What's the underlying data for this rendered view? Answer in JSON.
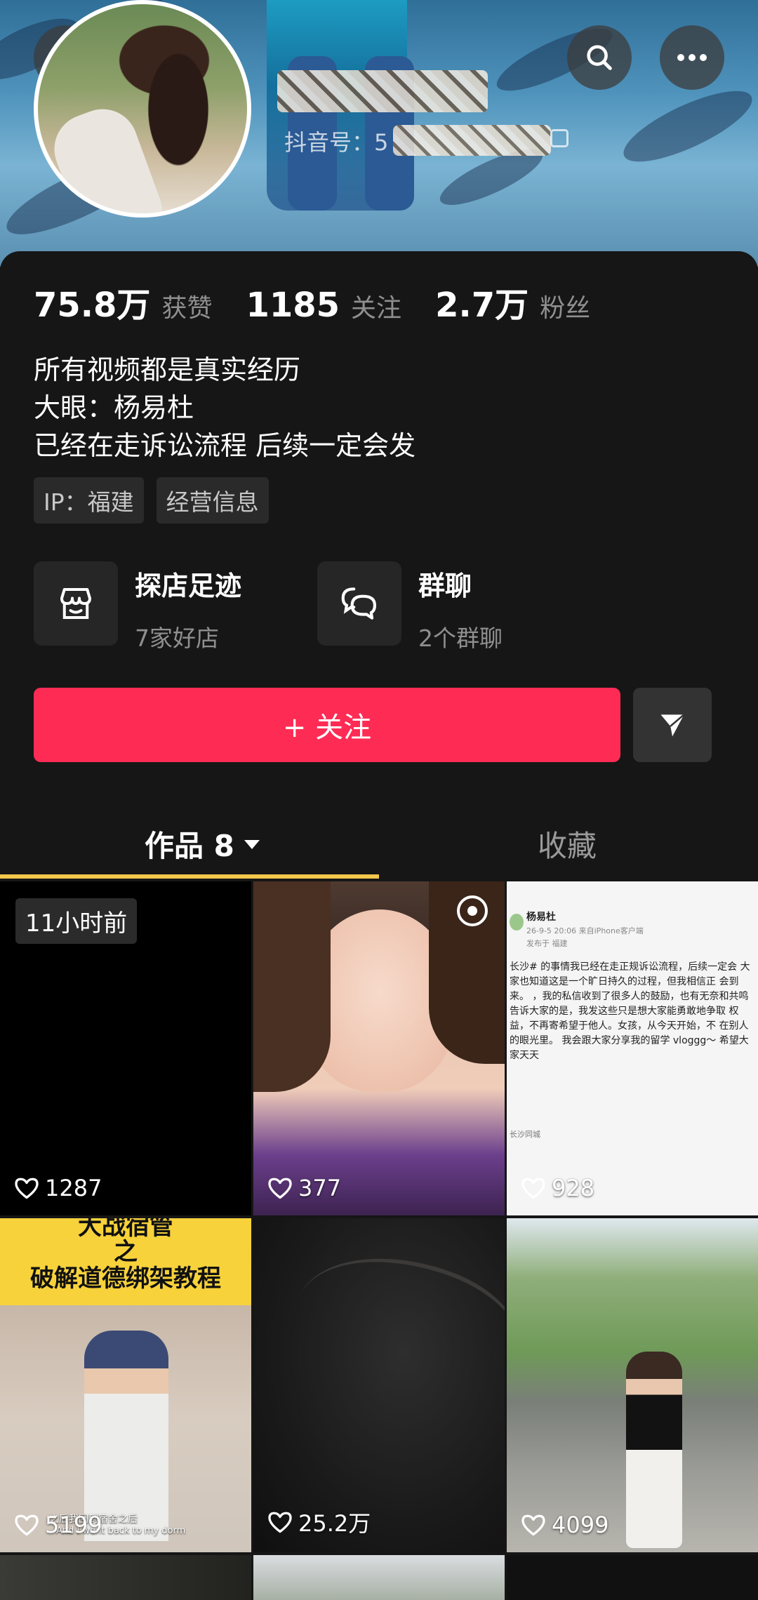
{
  "header": {
    "back_icon": "chevron-left-icon",
    "search_icon": "search-icon",
    "more_icon": "more-horizontal-icon",
    "douyin_id_label": "抖音号：5",
    "username_obscured": ""
  },
  "stats": [
    {
      "value": "75.8万",
      "label": "获赞"
    },
    {
      "value": "1185",
      "label": "关注"
    },
    {
      "value": "2.7万",
      "label": "粉丝"
    }
  ],
  "bio": {
    "lines": [
      "所有视频都是真实经历",
      "大眼：杨易杜",
      "已经在走诉讼流程 后续一定会发"
    ]
  },
  "tags": [
    "IP：福建",
    "经营信息"
  ],
  "features": [
    {
      "title": "探店足迹",
      "subtitle": "7家好店",
      "icon": "store-icon"
    },
    {
      "title": "群聊",
      "subtitle": "2个群聊",
      "icon": "chat-bubbles-icon"
    }
  ],
  "actions": {
    "follow_label": "+ 关注",
    "send_icon": "send-icon"
  },
  "tabs": {
    "works": "作品 8",
    "favorites": "收藏"
  },
  "videos": [
    {
      "likes": "1287",
      "time": "11小时前"
    },
    {
      "likes": "377"
    },
    {
      "likes": "928",
      "post_author": "杨易杜",
      "post_meta": "26-9-5 20:06 来自iPhone客户端",
      "post_loc": "发布于 福建",
      "post_text": "长沙# 的事情我已经在走正规诉讼流程，后续一定会 大家也知道这是一个旷日持久的过程，但我相信正 会到来。 ，我的私信收到了很多人的鼓励，也有无奈和共鸣 告诉大家的是，我发这些只是想大家能勇敢地争取 权益，不再寄希望于他人。女孩，从今天开始，不 在别人的眼光里。 我会跟大家分享我的留学 vloggg～ 希望大家天天",
      "post_footer": "长沙同城"
    },
    {
      "likes": "5199",
      "banner_line1": "大战宿管",
      "banner_line2": "之",
      "banner_line3": "破解道德绑架教程",
      "subtitle_cn": "之后我回到宿舍之后",
      "subtitle_en": "And I went back to my dorm"
    },
    {
      "likes": "25.2万"
    },
    {
      "likes": "4099"
    }
  ],
  "colors": {
    "accent": "#fe2c55",
    "tab_indicator": "#f3c74b",
    "background": "#161616"
  }
}
